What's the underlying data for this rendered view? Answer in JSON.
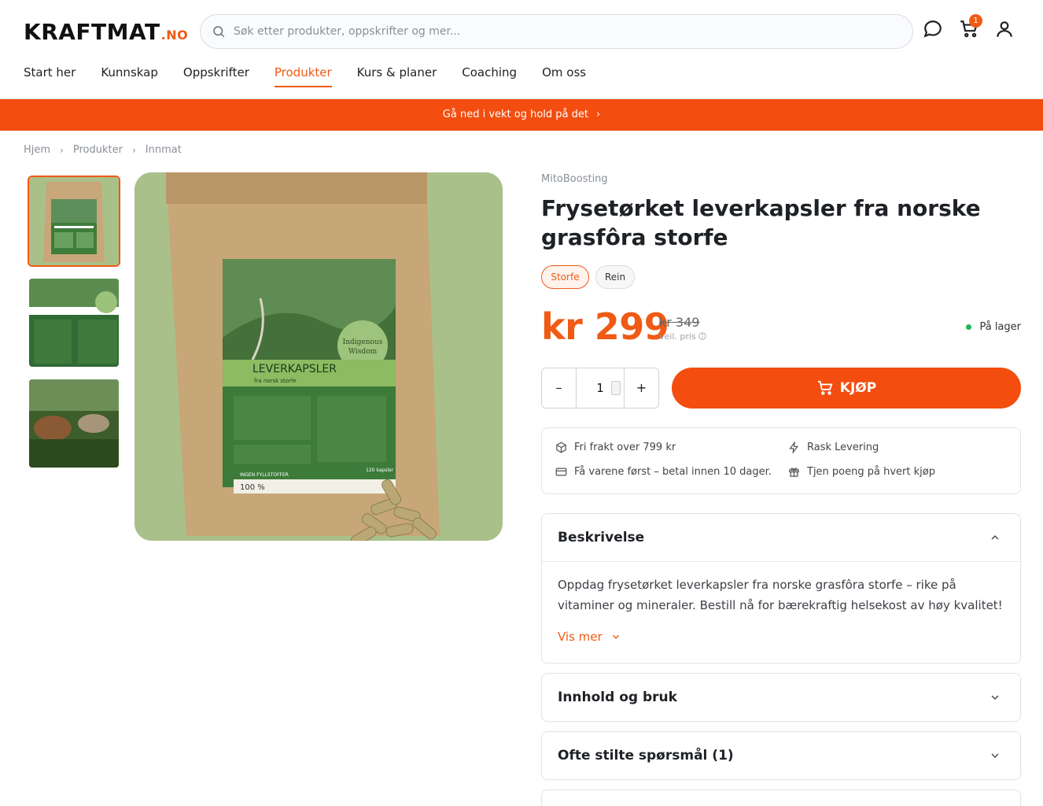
{
  "header": {
    "logo": "KRAFTMAT",
    "logo_tld": ".NO",
    "search_placeholder": "Søk etter produkter, oppskrifter og mer...",
    "cart_count": "1"
  },
  "nav": {
    "items": [
      {
        "label": "Start her"
      },
      {
        "label": "Kunnskap"
      },
      {
        "label": "Oppskrifter"
      },
      {
        "label": "Produkter",
        "active": true
      },
      {
        "label": "Kurs & planer"
      },
      {
        "label": "Coaching"
      },
      {
        "label": "Om oss"
      }
    ]
  },
  "banner": {
    "text": "Gå ned i vekt og hold på det"
  },
  "breadcrumb": [
    "Hjem",
    "Produkter",
    "Innmat"
  ],
  "product": {
    "brand": "MitoBoosting",
    "title": "Frysetørket leverkapsler fra norske grasfôra storfe",
    "variants": [
      {
        "label": "Storfe",
        "selected": true
      },
      {
        "label": "Rein",
        "selected": false
      }
    ],
    "price": "kr 299",
    "old_price": "kr 349",
    "recommended_label": "veil. pris",
    "stock": "På lager",
    "quantity": "1",
    "buy_label": "KJØP",
    "image_text": {
      "product_name": "LEVERKAPSLER",
      "subtitle": "fra norsk storfe",
      "logo_line1": "Indigenous",
      "logo_line2": "Wisdom",
      "count": "120 kapsler",
      "footer": "100 %",
      "fill": "INGEN FYLLSTOFFER"
    }
  },
  "perks": [
    {
      "icon": "package-icon",
      "label": "Fri frakt over 799 kr"
    },
    {
      "icon": "lightning-icon",
      "label": "Rask Levering"
    },
    {
      "icon": "card-icon",
      "label": "Få varene først – betal innen 10 dager."
    },
    {
      "icon": "gift-icon",
      "label": "Tjen poeng på hvert kjøp"
    }
  ],
  "accordions": {
    "description": {
      "title": "Beskrivelse",
      "text": "Oppdag frysetørket leverkapsler fra norske grasfôra storfe – rike på vitaminer og mineraler. Bestill nå for bærekraftig helsekost av høy kvalitet!",
      "more": "Vis mer"
    },
    "usage": {
      "title": "Innhold og bruk"
    },
    "faq": {
      "title": "Ofte stilte spørsmål (1)"
    }
  },
  "colors": {
    "accent": "#f34d0f",
    "stock_green": "#22b35a"
  }
}
